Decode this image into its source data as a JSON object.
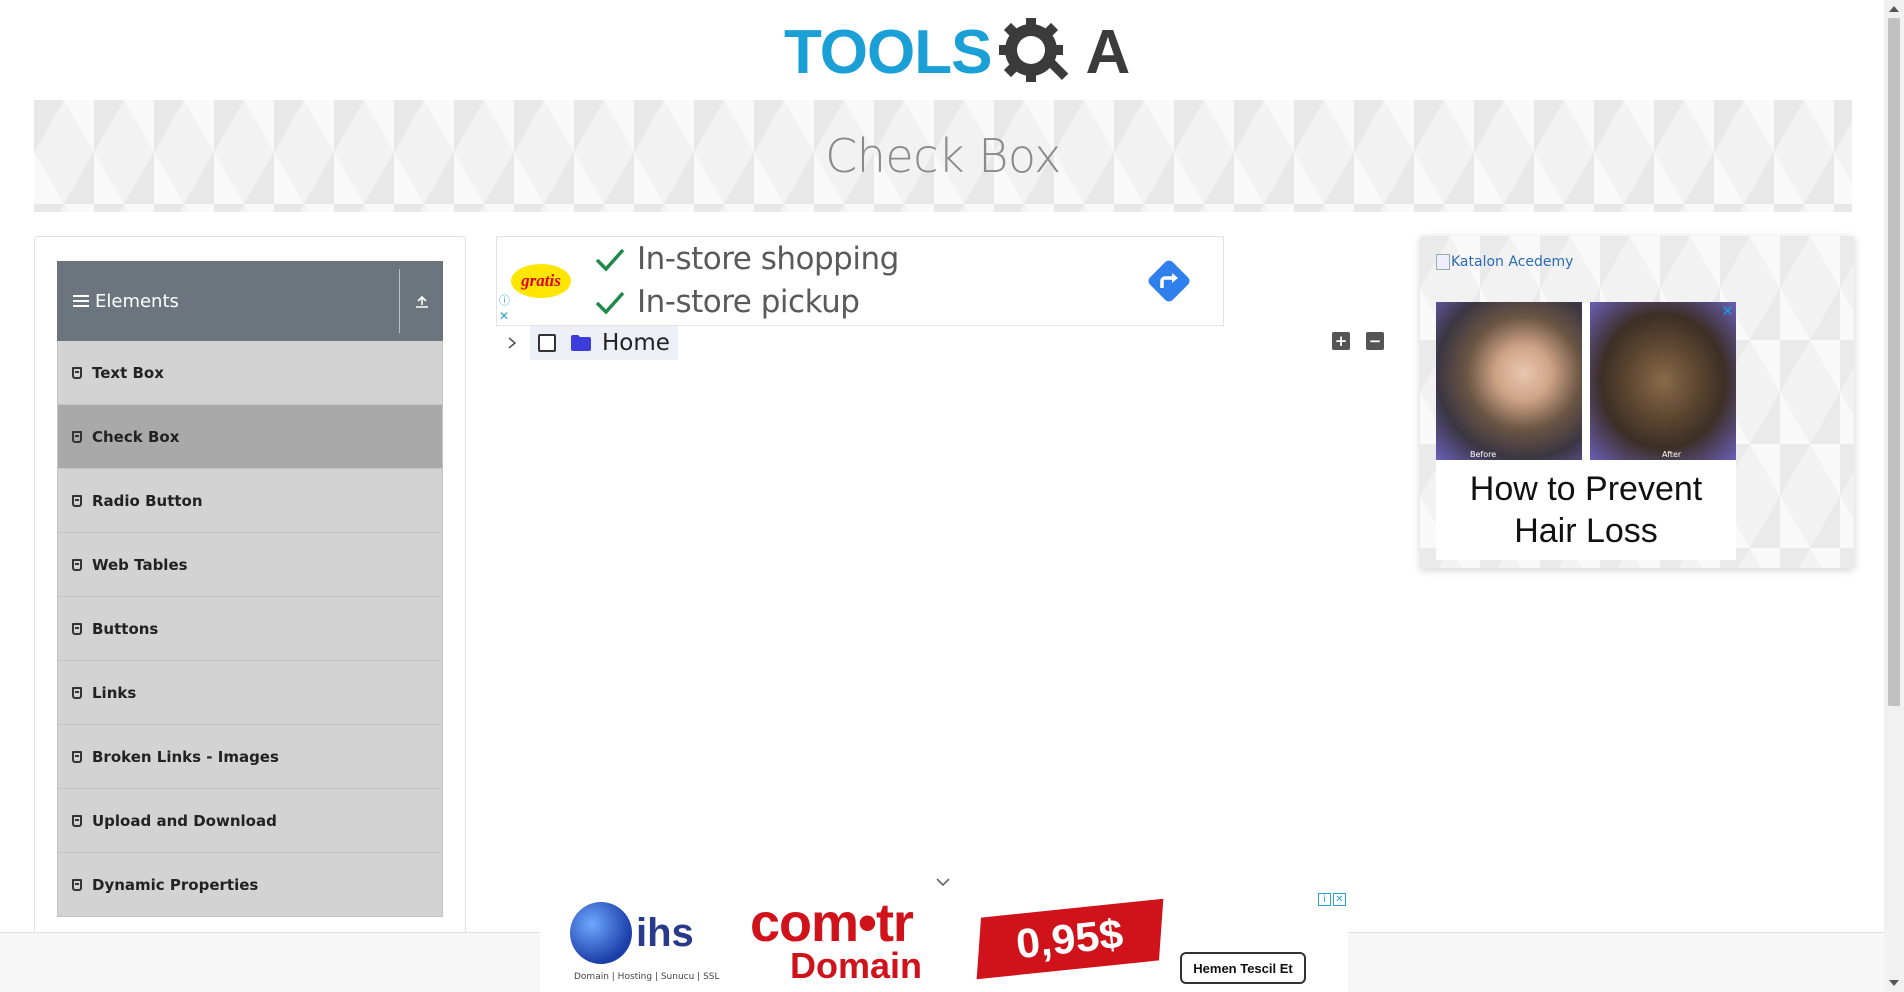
{
  "header": {
    "logo_tools": "TOOLS",
    "logo_a": "A"
  },
  "banner": {
    "title": "Check Box"
  },
  "sidebar": {
    "group": {
      "title": "Elements"
    },
    "items": [
      {
        "label": "Text Box",
        "active": false
      },
      {
        "label": "Check Box",
        "active": true
      },
      {
        "label": "Radio Button",
        "active": false
      },
      {
        "label": "Web Tables",
        "active": false
      },
      {
        "label": "Buttons",
        "active": false
      },
      {
        "label": "Links",
        "active": false
      },
      {
        "label": "Broken Links - Images",
        "active": false
      },
      {
        "label": "Upload and Download",
        "active": false
      },
      {
        "label": "Dynamic Properties",
        "active": false
      }
    ]
  },
  "top_ad": {
    "brand": "gratis",
    "line1": "In-store shopping",
    "line2": "In-store pickup"
  },
  "tree": {
    "root_label": "Home",
    "expand_all": "+",
    "collapse_all": "−"
  },
  "right_ad": {
    "link_text": "Katalon Acedemy",
    "before_label": "Before",
    "after_label": "After",
    "caption": "How to Prevent Hair Loss"
  },
  "bottom_ad": {
    "brand": "ihs",
    "sub": "Domain | Hosting | Sunucu | SSL",
    "headline": "com•tr",
    "product": "Domain",
    "price": "0,95$",
    "cta": "Hemen Tescil Et"
  },
  "colors": {
    "accent_blue": "#1a9fd6",
    "sidebar_header": "#6c757d",
    "menu_bg": "#d3d3d3",
    "menu_active_bg": "#a9a9a9"
  }
}
